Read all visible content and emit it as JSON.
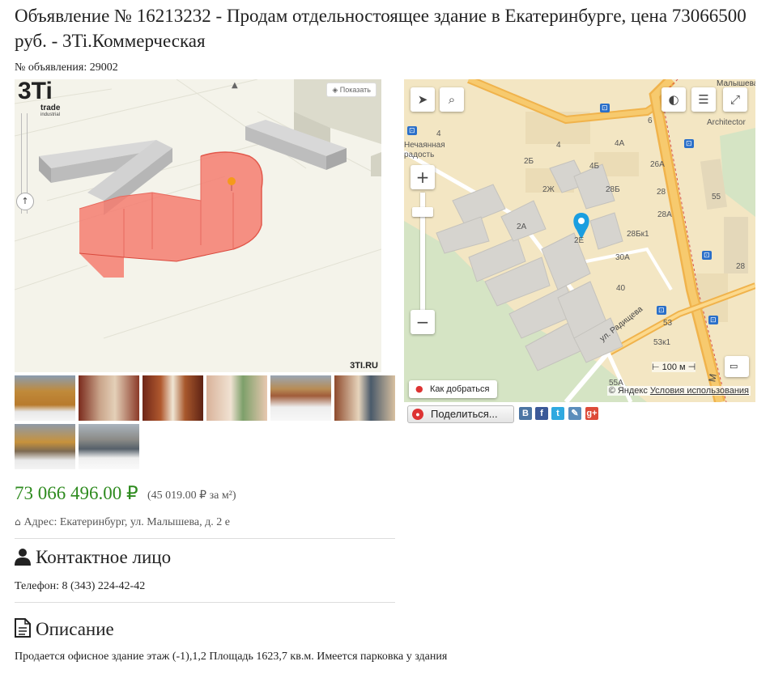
{
  "title": "Объявление № 16213232 - Продам отдельностоящее здание в Екатеринбурге, цена 73066500 руб. - 3Ti.Коммерческая",
  "ad_number_label": "№ объявления: 29002",
  "view3d": {
    "show_button": "Показать",
    "watermark": "3TI.RU",
    "logo_main": "3Ti",
    "logo_sub1": "trade",
    "logo_sub2": "industrial"
  },
  "thumbnails": [
    {
      "icon": "photo-building-exterior"
    },
    {
      "icon": "photo-corridor"
    },
    {
      "icon": "photo-corridor-door"
    },
    {
      "icon": "photo-office-room"
    },
    {
      "icon": "photo-yard-winter"
    },
    {
      "icon": "photo-office-desk"
    },
    {
      "icon": "photo-street-view"
    },
    {
      "icon": "photo-building-exterior-2"
    },
    {
      "icon": "photo-courtyard-cars"
    }
  ],
  "map": {
    "route_button": "Как добраться",
    "copyright": "© Яндекс",
    "terms_link": "Условия использования",
    "scale": "100 м",
    "labels": {
      "station": "Нечаянная радость",
      "architector": "Architector",
      "street_radishcheva": "ул. Радищева",
      "street_malysheva_top": "Малышева",
      "street_malysheva_side": "М"
    },
    "house_numbers": [
      "4",
      "6",
      "4",
      "4А",
      "2Б",
      "4Б",
      "26А",
      "2Ж",
      "28Б",
      "28",
      "55",
      "2А",
      "28А",
      "2Е",
      "28Бк1",
      "30А",
      "28",
      "40",
      "53",
      "53к1",
      "55А"
    ]
  },
  "share": {
    "button_label": "Поделиться...",
    "networks": [
      "vk",
      "facebook",
      "twitter",
      "livejournal",
      "google-plus"
    ]
  },
  "price": "73 066 496.00 ₽",
  "price_per": "(45 019.00 ₽ за м²)",
  "address": "Адрес: Екатеринбург, ул. Малышева, д. 2 е",
  "contact_heading": "Контактное лицо",
  "phone": "Телефон: 8 (343) 224-42-42",
  "description_heading": "Описание",
  "description": "Продается офисное здание этаж (-1),1,2 Площадь 1623,7 кв.м. Имеется парковка у здания",
  "colors": {
    "price": "#2e8b1f",
    "building_highlight": "#f47c70",
    "map_road": "#f0b34c",
    "map_pin": "#1a9ee0"
  }
}
